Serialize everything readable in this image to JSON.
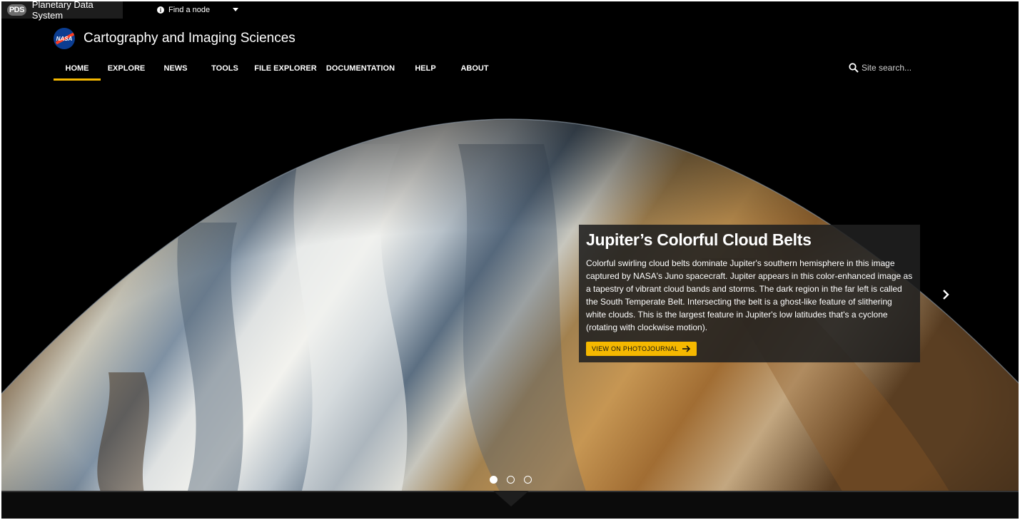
{
  "pds_bar": {
    "title": "Planetary Data System",
    "logo_text": "PDS",
    "node_finder_label": "Find a node",
    "info_icon": "info-icon",
    "caret_icon": "caret-down-icon"
  },
  "site": {
    "logo_text": "NASA",
    "title": "Cartography and Imaging Sciences"
  },
  "nav": {
    "tabs": [
      {
        "label": "HOME",
        "active": true
      },
      {
        "label": "EXPLORE",
        "active": false
      },
      {
        "label": "NEWS",
        "active": false
      },
      {
        "label": "TOOLS",
        "active": false
      },
      {
        "label": "FILE EXPLORER",
        "active": false
      },
      {
        "label": "DOCUMENTATION",
        "active": false
      },
      {
        "label": "HELP",
        "active": false
      },
      {
        "label": "ABOUT",
        "active": false
      }
    ],
    "accent_color": "#f5b800"
  },
  "search": {
    "placeholder": "Site search...",
    "icon": "search-icon"
  },
  "hero": {
    "title": "Jupiter’s Colorful Cloud Belts",
    "description": "Colorful swirling cloud belts dominate Jupiter's southern hemisphere in this image captured by NASA's Juno spacecraft. Jupiter appears in this color-enhanced image as a tapestry of vibrant cloud bands and storms. The dark region in the far left is called the South Temperate Belt. Intersecting the belt is a ghost-like feature of slithering white clouds. This is the largest feature in Jupiter's low latitudes that's a cyclone (rotating with clockwise motion).",
    "button_label": "VIEW ON PHOTOJOURNAL",
    "button_icon": "arrow-right-icon",
    "next_icon": "chevron-right-icon",
    "slides_total": 3,
    "active_slide": 1
  }
}
